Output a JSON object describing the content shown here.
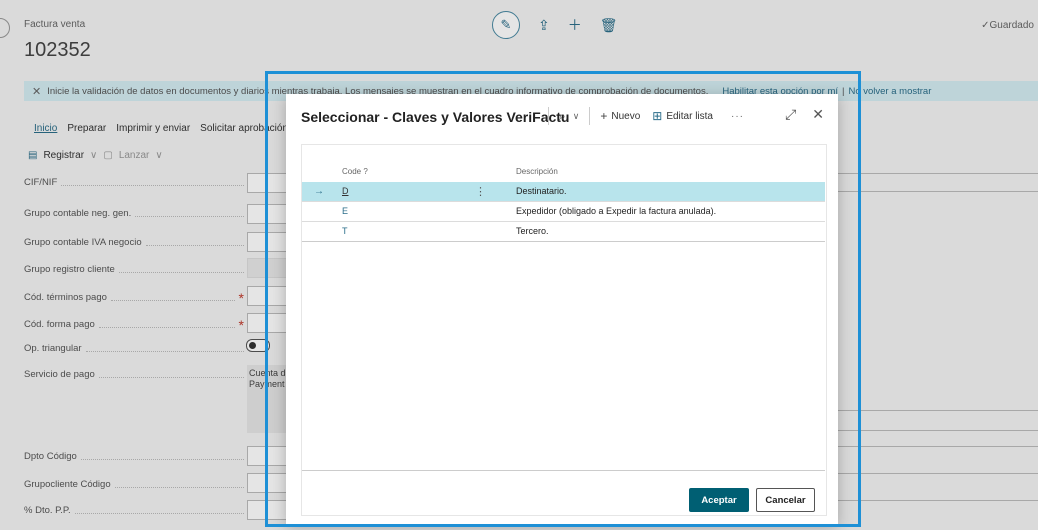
{
  "page": {
    "doc_type": "Factura venta",
    "doc_number": "102352",
    "saved_status": "Guardado",
    "saved_check": "✓",
    "info_bar": {
      "message": "Inicie la validación de datos en documentos y diarios mientras trabaja. Los mensajes se muestran en el cuadro informativo de comprobación de documentos.",
      "enable_link": "Habilitar esta opción por mí",
      "separator": "|",
      "dismiss_link": "No volver a mostrar"
    },
    "menu": [
      "Inicio",
      "Preparar",
      "Imprimir y enviar",
      "Solicitar aprobación"
    ],
    "actions": {
      "register": "Registrar",
      "launch": "Lanzar"
    },
    "fields": [
      "CIF/NIF",
      "Grupo contable neg. gen.",
      "Grupo contable IVA negocio",
      "Grupo registro cliente",
      "Cód. términos pago",
      "Cód. forma pago",
      "Op. triangular",
      "Servicio de pago",
      "Dpto Código",
      "Grupocliente Código",
      "% Dto. P.P."
    ],
    "service_value_1": "Cuenta d",
    "service_value_2": "Payment"
  },
  "modal": {
    "title": "Seleccionar - Claves y Valores VeriFactu",
    "new_label": "Nuevo",
    "edit_list_label": "Editar lista",
    "more_label": "···",
    "columns": {
      "code": "Code ?",
      "description": "Descripción"
    },
    "rows": [
      {
        "code": "D",
        "description": "Destinatario."
      },
      {
        "code": "E",
        "description": "Expedidor (obligado a Expedir la factura anulada)."
      },
      {
        "code": "T",
        "description": "Tercero."
      }
    ],
    "accept_label": "Aceptar",
    "cancel_label": "Cancelar"
  },
  "colors": {
    "accent": "#005f73",
    "selected_row": "#b8e4ec",
    "highlight_frame": "#1e90d6",
    "info_bar": "#d4ecf2"
  }
}
